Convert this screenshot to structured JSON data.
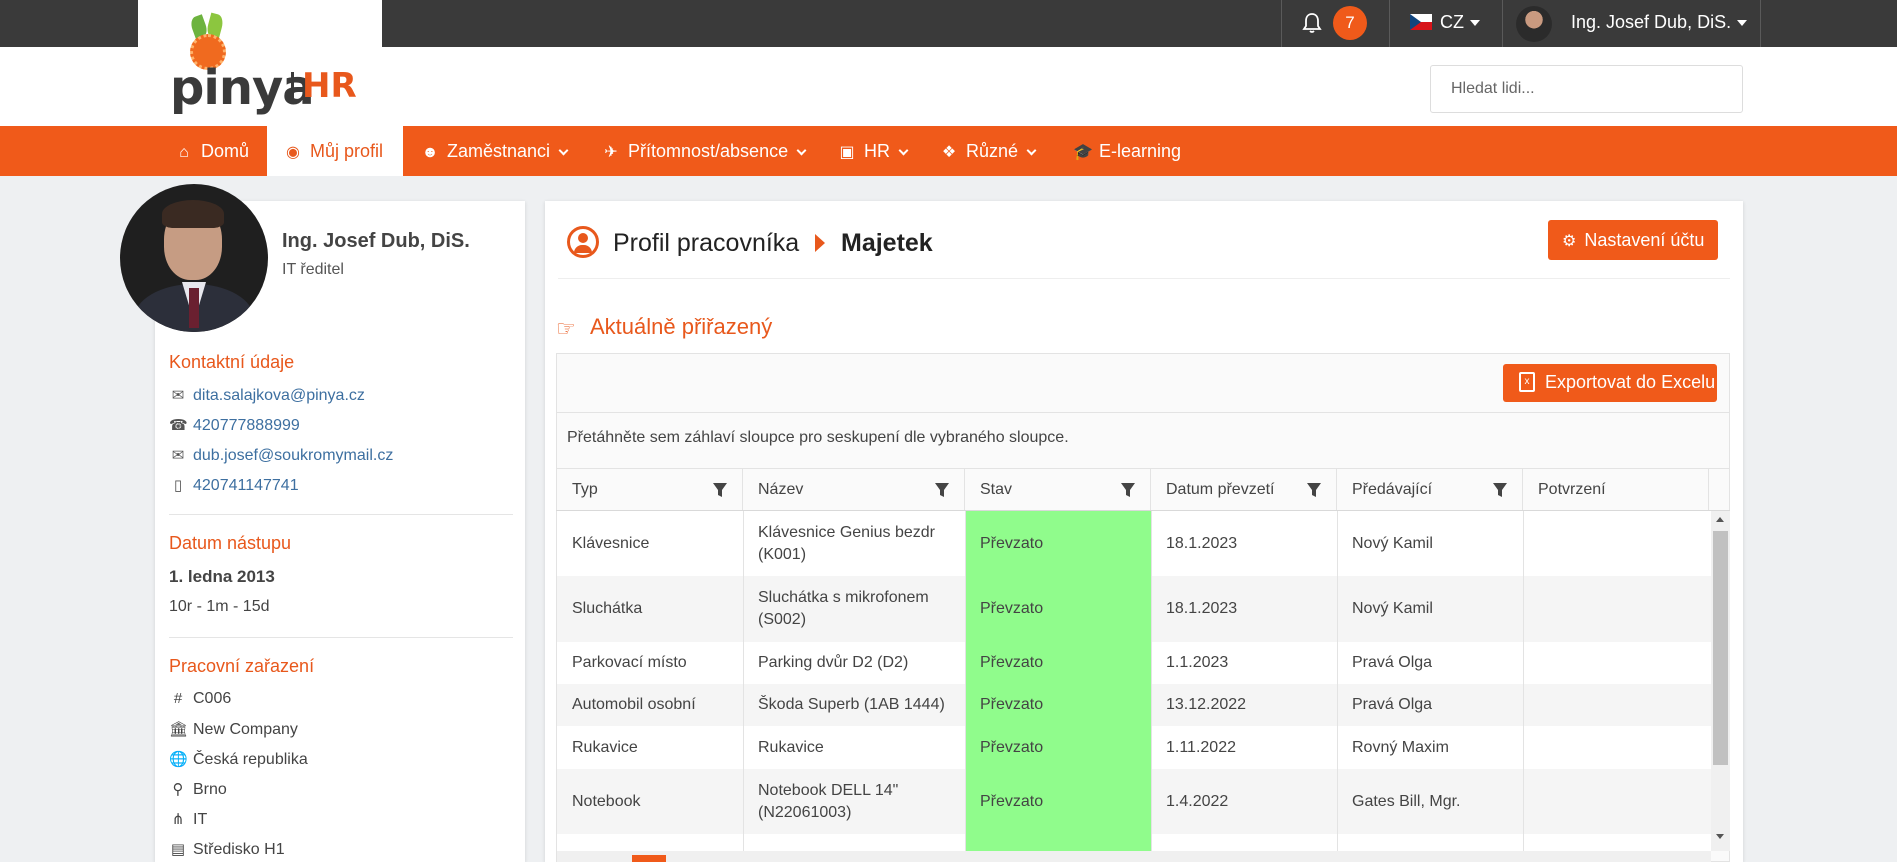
{
  "brand": {
    "word": "pinya",
    "hr": "HR"
  },
  "topbar": {
    "notifications_count": "7",
    "language": "CZ",
    "user_name": "Ing. Josef Dub, DiS."
  },
  "search": {
    "placeholder": "Hledat lidi..."
  },
  "nav": {
    "items": [
      {
        "label": "Domů",
        "icon": "home-icon"
      },
      {
        "label": "Můj profil",
        "icon": "user-circle-icon",
        "active": true
      },
      {
        "label": "Zaměstnanci",
        "icon": "users-icon"
      },
      {
        "label": "Přítomnost/absence",
        "icon": "plane-icon"
      },
      {
        "label": "HR",
        "icon": "id-badge-icon"
      },
      {
        "label": "Různé",
        "icon": "cubes-icon"
      },
      {
        "label": "E-learning",
        "icon": "graduation-cap-icon"
      }
    ]
  },
  "profile": {
    "name": "Ing. Josef Dub, DiS.",
    "title": "IT ředitel",
    "contact_heading": "Kontaktní údaje",
    "contacts": [
      {
        "icon": "envelope-icon",
        "value": "dita.salajkova@pinya.cz"
      },
      {
        "icon": "phone-icon",
        "value": "420777888999"
      },
      {
        "icon": "envelope-icon",
        "value": "dub.josef@soukromymail.cz"
      },
      {
        "icon": "mobile-icon",
        "value": "420741147741"
      }
    ],
    "start_heading": "Datum nástupu",
    "start_date": "1. ledna 2013",
    "tenure": "10r - 1m - 15d",
    "position_heading": "Pracovní zařazení",
    "position": [
      {
        "icon": "hash-icon",
        "value": "C006"
      },
      {
        "icon": "bank-icon",
        "value": "New Company"
      },
      {
        "icon": "globe-icon",
        "value": "Česká republika"
      },
      {
        "icon": "map-marker-icon",
        "value": "Brno"
      },
      {
        "icon": "sitemap-icon",
        "value": "IT"
      },
      {
        "icon": "building-icon",
        "value": "Středisko H1"
      }
    ]
  },
  "main": {
    "breadcrumb_1": "Profil pracovníka",
    "breadcrumb_2": "Majetek",
    "settings_button": "Nastavení účtu",
    "section_title": "Aktuálně přiřazený",
    "export_button": "Exportovat do Excelu",
    "group_hint": "Přetáhněte sem záhlaví sloupce pro seskupení dle vybraného sloupce.",
    "columns": [
      "Typ",
      "Název",
      "Stav",
      "Datum převzetí",
      "Předávající",
      "Potvrzení"
    ],
    "rows": [
      {
        "typ": "Klávesnice",
        "nazev": "Klávesnice Genius bezdr (K001)",
        "stav": "Převzato",
        "datum": "18.1.2023",
        "predavajici": "Nový Kamil",
        "potvrzeni": ""
      },
      {
        "typ": "Sluchátka",
        "nazev": "Sluchátka s mikrofonem (S002)",
        "stav": "Převzato",
        "datum": "18.1.2023",
        "predavajici": "Nový Kamil",
        "potvrzeni": ""
      },
      {
        "typ": "Parkovací místo",
        "nazev": "Parking dvůr D2 (D2)",
        "stav": "Převzato",
        "datum": "1.1.2023",
        "predavajici": "Pravá Olga",
        "potvrzeni": ""
      },
      {
        "typ": "Automobil osobní",
        "nazev": "Škoda Superb (1AB 1444)",
        "stav": "Převzato",
        "datum": "13.12.2022",
        "predavajici": "Pravá Olga",
        "potvrzeni": ""
      },
      {
        "typ": "Rukavice",
        "nazev": "Rukavice",
        "stav": "Převzato",
        "datum": "1.11.2022",
        "predavajici": "Rovný Maxim",
        "potvrzeni": ""
      },
      {
        "typ": "Notebook",
        "nazev": "Notebook DELL 14\" (N22061003)",
        "stav": "Převzato",
        "datum": "1.4.2022",
        "predavajici": "Gates Bill, Mgr.",
        "potvrzeni": ""
      }
    ]
  },
  "colors": {
    "accent": "#f05a1a",
    "status_ok": "#90fc8c",
    "topbar": "#3a3a3a"
  }
}
